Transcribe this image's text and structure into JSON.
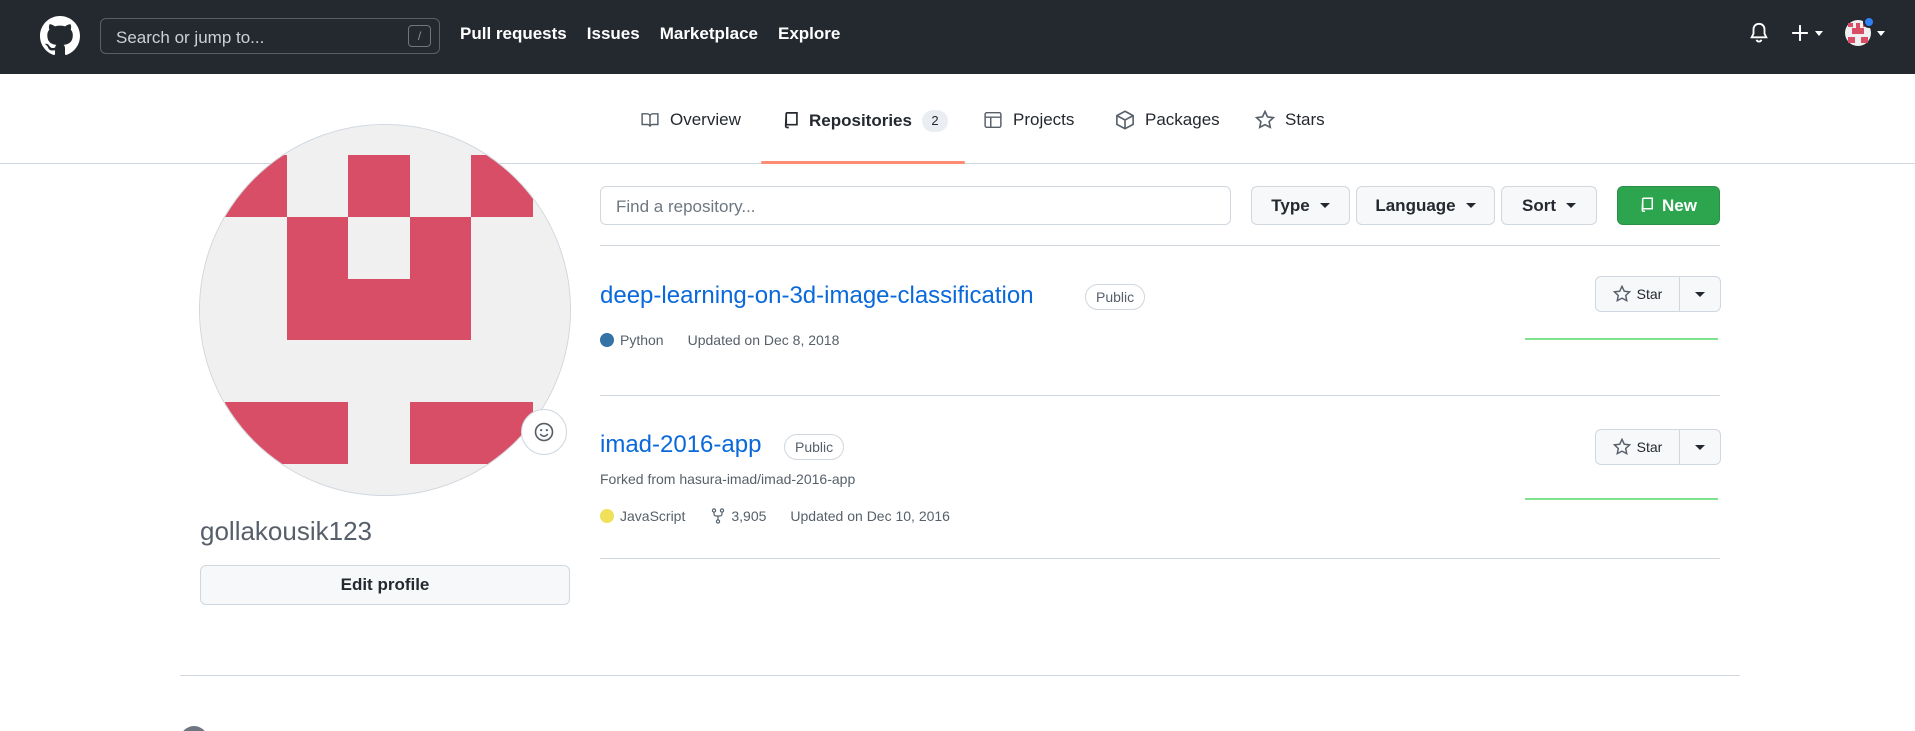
{
  "header": {
    "search_placeholder": "Search or jump to...",
    "search_shortcut": "/",
    "nav": [
      "Pull requests",
      "Issues",
      "Marketplace",
      "Explore"
    ],
    "bg_color": "#24292f"
  },
  "tabs": [
    {
      "label": "Overview",
      "icon": "book-icon"
    },
    {
      "label": "Repositories",
      "icon": "repo-icon",
      "count": "2",
      "selected": true
    },
    {
      "label": "Projects",
      "icon": "table-icon"
    },
    {
      "label": "Packages",
      "icon": "package-icon"
    },
    {
      "label": "Stars",
      "icon": "star-icon"
    }
  ],
  "profile": {
    "username": "gollakousik123",
    "edit_label": "Edit profile",
    "avatar_color": "#d84e66"
  },
  "filters": {
    "find_placeholder": "Find a repository...",
    "type_label": "Type",
    "language_label": "Language",
    "sort_label": "Sort",
    "new_label": "New"
  },
  "repos": [
    {
      "name": "deep-learning-on-3d-image-classification",
      "visibility": "Public",
      "language": "Python",
      "language_color": "#3572A5",
      "updated": "Updated on Dec 8, 2018",
      "star_label": "Star"
    },
    {
      "name": "imad-2016-app",
      "visibility": "Public",
      "forked_from": "Forked from hasura-imad/imad-2016-app",
      "language": "JavaScript",
      "language_color": "#f1e05a",
      "forks": "3,905",
      "updated": "Updated on Dec 10, 2016",
      "star_label": "Star"
    }
  ]
}
